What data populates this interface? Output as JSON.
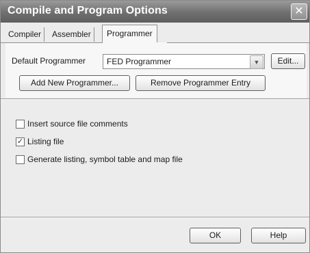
{
  "window": {
    "title": "Compile and Program Options",
    "close_symbol": "✕"
  },
  "tabs": [
    {
      "label": "Compiler",
      "active": false
    },
    {
      "label": "Assembler",
      "active": false
    },
    {
      "label": "Programmer",
      "active": true
    }
  ],
  "programmer": {
    "default_label": "Default Programmer",
    "selected_value": "FED Programmer",
    "dropdown_arrow": "▼",
    "edit_label": "Edit...",
    "add_label": "Add New Programmer...",
    "remove_label": "Remove Programmer Entry"
  },
  "options": [
    {
      "label": "Insert source file comments",
      "checked": false,
      "mark": ""
    },
    {
      "label": "Listing file",
      "checked": true,
      "mark": "✓"
    },
    {
      "label": "Generate listing, symbol table and map file",
      "checked": false,
      "mark": ""
    }
  ],
  "footer": {
    "ok_label": "OK",
    "help_label": "Help"
  }
}
